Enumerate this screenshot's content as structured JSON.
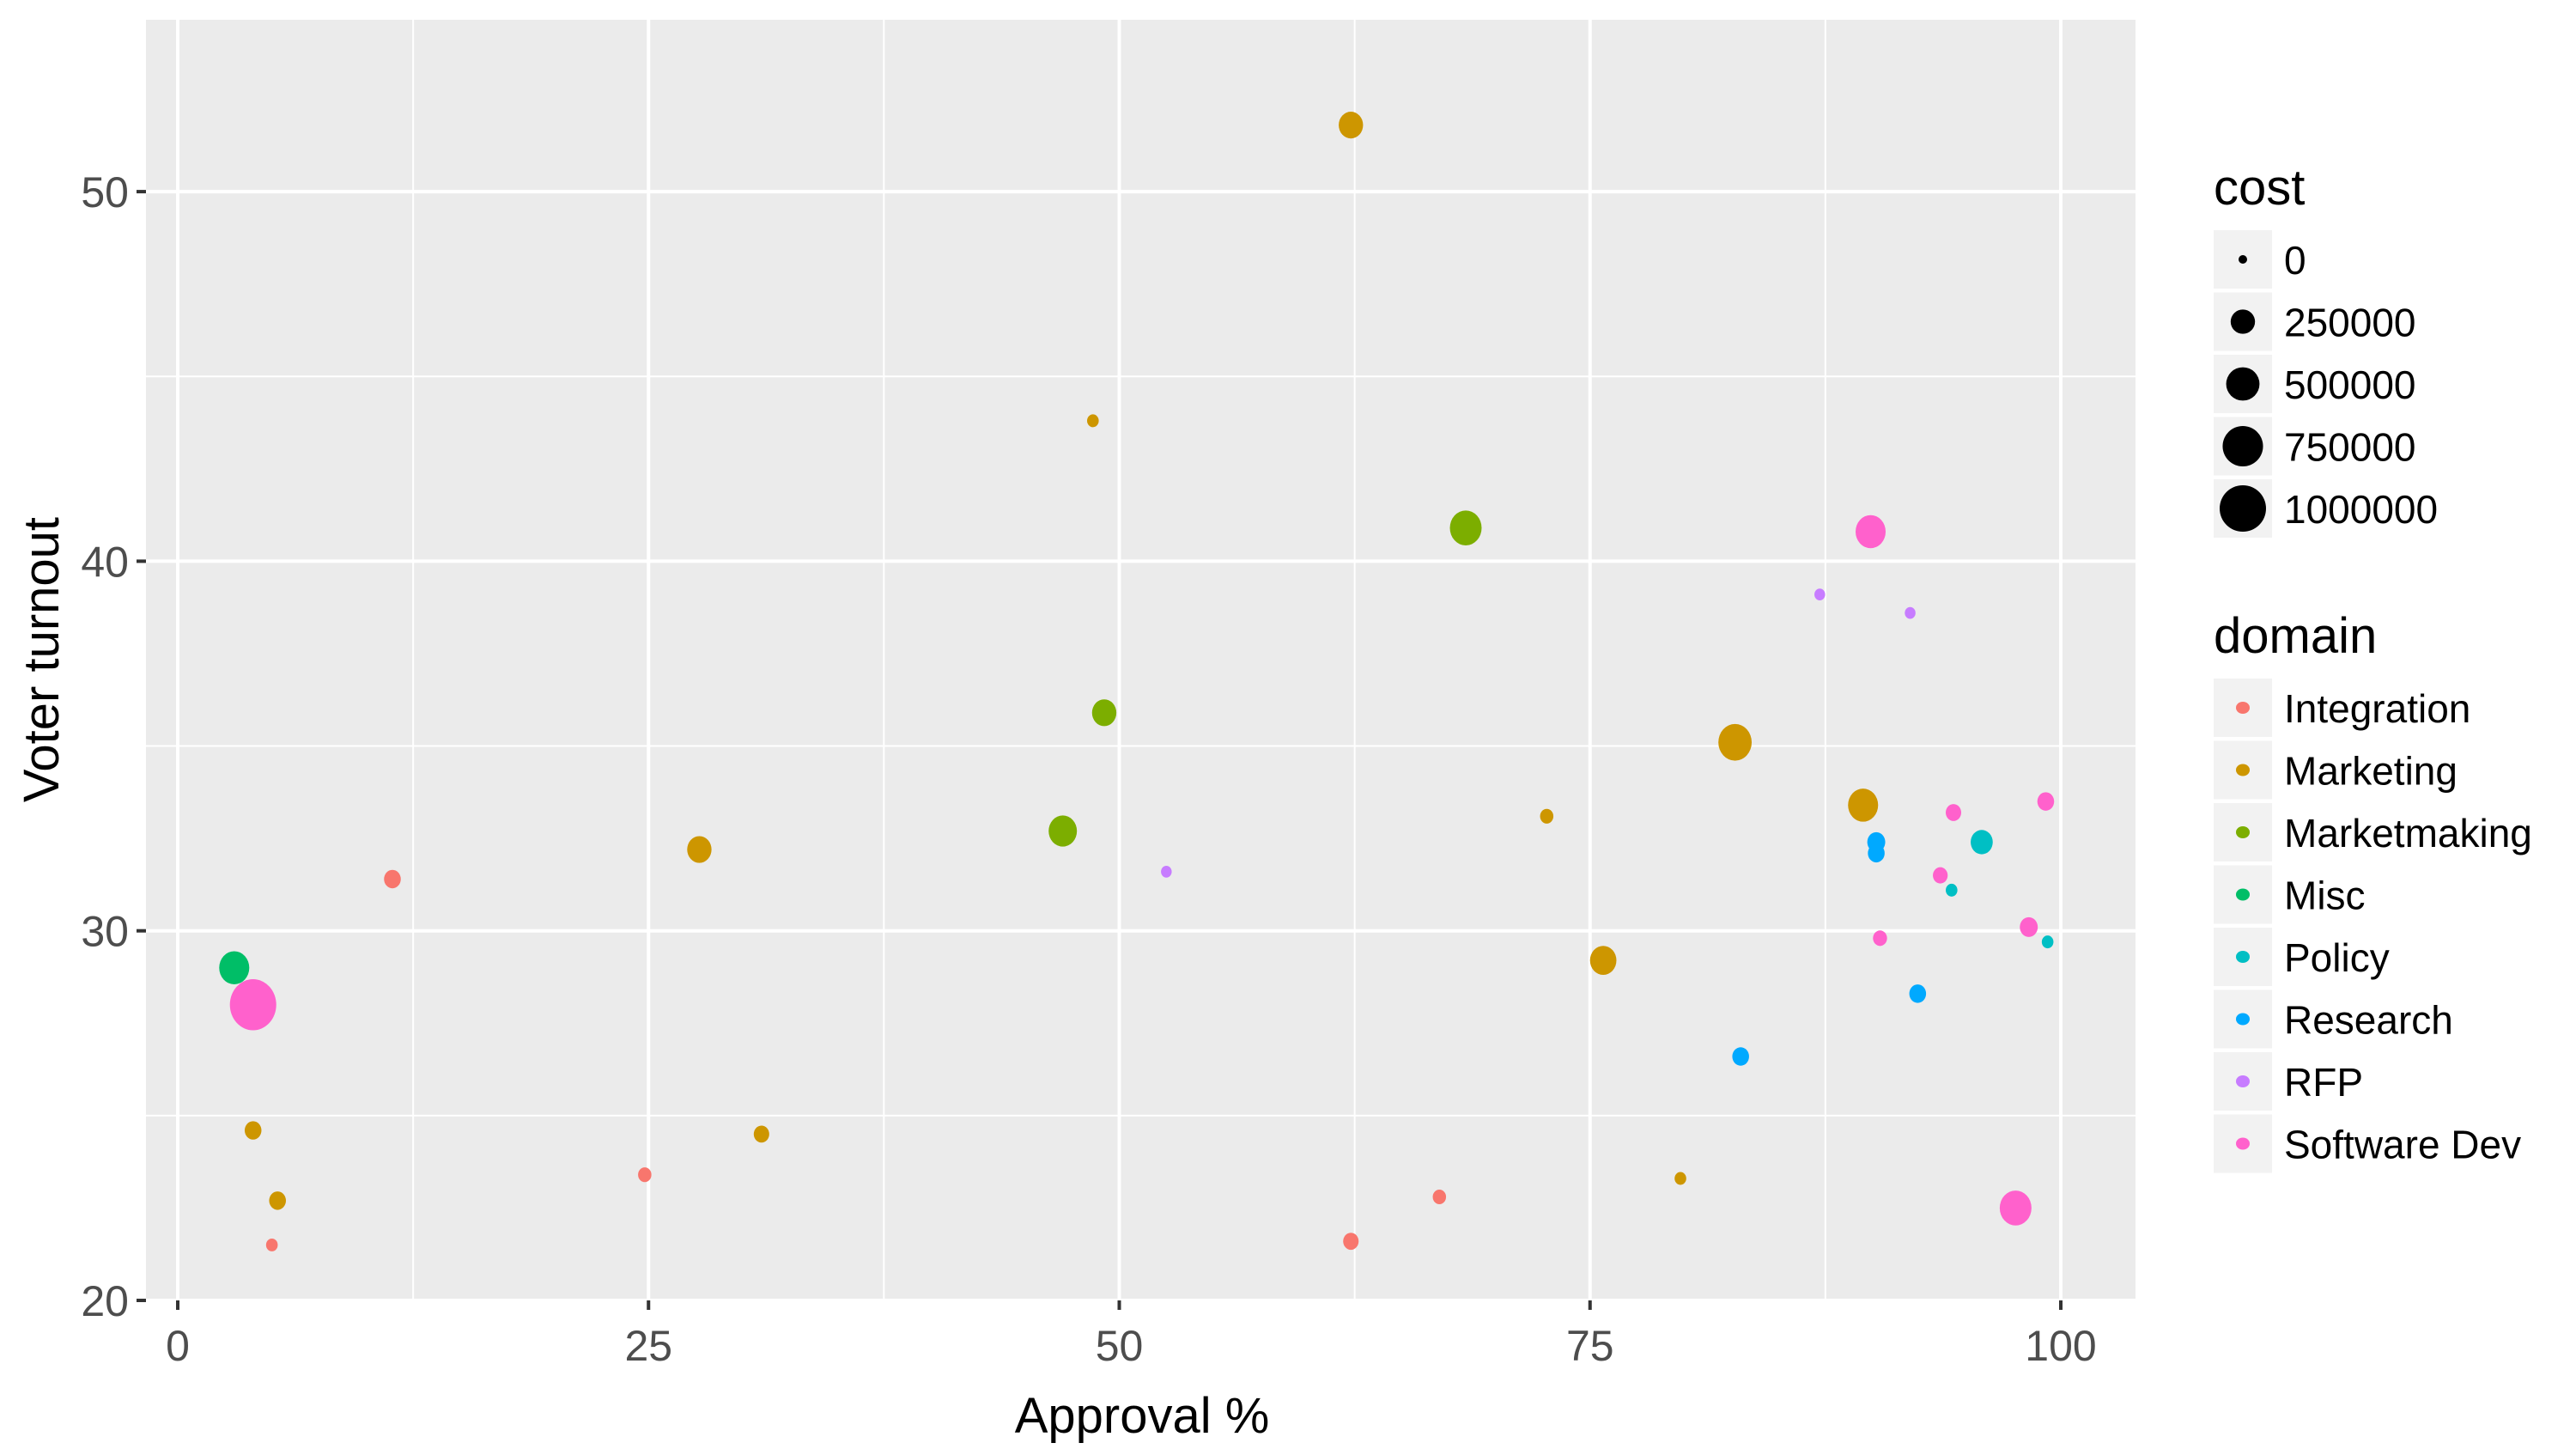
{
  "chart_data": {
    "type": "scatter",
    "title": "",
    "xlabel": "Approval %",
    "ylabel": "Voter turnout",
    "xlim": [
      -2,
      104
    ],
    "ylim": [
      20,
      53
    ],
    "x_ticks": [
      0,
      25,
      50,
      75,
      100
    ],
    "x_tick_labels": [
      "0",
      "25",
      "50",
      "75",
      "100"
    ],
    "y_ticks": [
      20,
      30,
      40,
      50
    ],
    "y_tick_labels": [
      "20",
      "30",
      "40",
      "50"
    ],
    "grid": true,
    "size_legend": {
      "title": "cost",
      "placement": "right",
      "entries": [
        {
          "label": "0",
          "value": 0
        },
        {
          "label": "250000",
          "value": 250000
        },
        {
          "label": "500000",
          "value": 500000
        },
        {
          "label": "750000",
          "value": 750000
        },
        {
          "label": "1000000",
          "value": 1000000
        }
      ]
    },
    "color_legend": {
      "title": "domain",
      "placement": "right",
      "entries": [
        {
          "label": "Integration",
          "color": "#F8766D"
        },
        {
          "label": "Marketing",
          "color": "#CD9600"
        },
        {
          "label": "Marketmaking",
          "color": "#7CAE00"
        },
        {
          "label": "Misc",
          "color": "#00BE67"
        },
        {
          "label": "Policy",
          "color": "#00BFC4"
        },
        {
          "label": "Research",
          "color": "#00A9FF"
        },
        {
          "label": "RFP",
          "color": "#C77CFF"
        },
        {
          "label": "Software Dev",
          "color": "#FF61CC"
        }
      ]
    },
    "series": [
      {
        "name": "Integration",
        "points": [
          {
            "x": 11.4,
            "y": 31.4,
            "cost": 100000
          },
          {
            "x": 24.8,
            "y": 23.4,
            "cost": 50000
          },
          {
            "x": 5.0,
            "y": 21.5,
            "cost": 30000
          },
          {
            "x": 62.3,
            "y": 21.6,
            "cost": 80000
          },
          {
            "x": 67.0,
            "y": 22.8,
            "cost": 50000
          }
        ]
      },
      {
        "name": "Marketing",
        "points": [
          {
            "x": 62.3,
            "y": 51.8,
            "cost": 250000
          },
          {
            "x": 48.6,
            "y": 43.8,
            "cost": 30000
          },
          {
            "x": 27.7,
            "y": 32.2,
            "cost": 250000
          },
          {
            "x": 72.7,
            "y": 33.1,
            "cost": 50000
          },
          {
            "x": 82.7,
            "y": 35.1,
            "cost": 500000
          },
          {
            "x": 89.5,
            "y": 33.4,
            "cost": 400000
          },
          {
            "x": 75.7,
            "y": 29.2,
            "cost": 300000
          },
          {
            "x": 4.0,
            "y": 24.6,
            "cost": 100000
          },
          {
            "x": 31.0,
            "y": 24.5,
            "cost": 80000
          },
          {
            "x": 5.3,
            "y": 22.7,
            "cost": 100000
          },
          {
            "x": 79.8,
            "y": 23.3,
            "cost": 30000
          }
        ]
      },
      {
        "name": "Marketmaking",
        "points": [
          {
            "x": 68.4,
            "y": 40.9,
            "cost": 450000
          },
          {
            "x": 49.2,
            "y": 35.9,
            "cost": 250000
          },
          {
            "x": 47.0,
            "y": 32.7,
            "cost": 350000
          }
        ]
      },
      {
        "name": "Misc",
        "points": [
          {
            "x": 3.0,
            "y": 29.0,
            "cost": 400000
          }
        ]
      },
      {
        "name": "Policy",
        "points": [
          {
            "x": 95.8,
            "y": 32.4,
            "cost": 200000
          },
          {
            "x": 94.2,
            "y": 31.1,
            "cost": 30000
          },
          {
            "x": 99.3,
            "y": 29.7,
            "cost": 30000
          }
        ]
      },
      {
        "name": "Research",
        "points": [
          {
            "x": 90.2,
            "y": 32.4,
            "cost": 120000
          },
          {
            "x": 90.2,
            "y": 32.1,
            "cost": 100000
          },
          {
            "x": 92.4,
            "y": 28.3,
            "cost": 100000
          },
          {
            "x": 83.0,
            "y": 26.6,
            "cost": 100000
          }
        ]
      },
      {
        "name": "RFP",
        "points": [
          {
            "x": 87.2,
            "y": 39.1,
            "cost": 20000
          },
          {
            "x": 92.0,
            "y": 38.6,
            "cost": 20000
          },
          {
            "x": 52.5,
            "y": 31.6,
            "cost": 20000
          }
        ]
      },
      {
        "name": "Software Dev",
        "points": [
          {
            "x": 89.9,
            "y": 40.8,
            "cost": 400000
          },
          {
            "x": 4.0,
            "y": 28.0,
            "cost": 1000000
          },
          {
            "x": 94.3,
            "y": 33.2,
            "cost": 80000
          },
          {
            "x": 99.2,
            "y": 33.5,
            "cost": 100000
          },
          {
            "x": 93.6,
            "y": 31.5,
            "cost": 70000
          },
          {
            "x": 90.4,
            "y": 29.8,
            "cost": 60000
          },
          {
            "x": 98.3,
            "y": 30.1,
            "cost": 120000
          },
          {
            "x": 97.6,
            "y": 22.5,
            "cost": 450000
          }
        ]
      }
    ]
  }
}
